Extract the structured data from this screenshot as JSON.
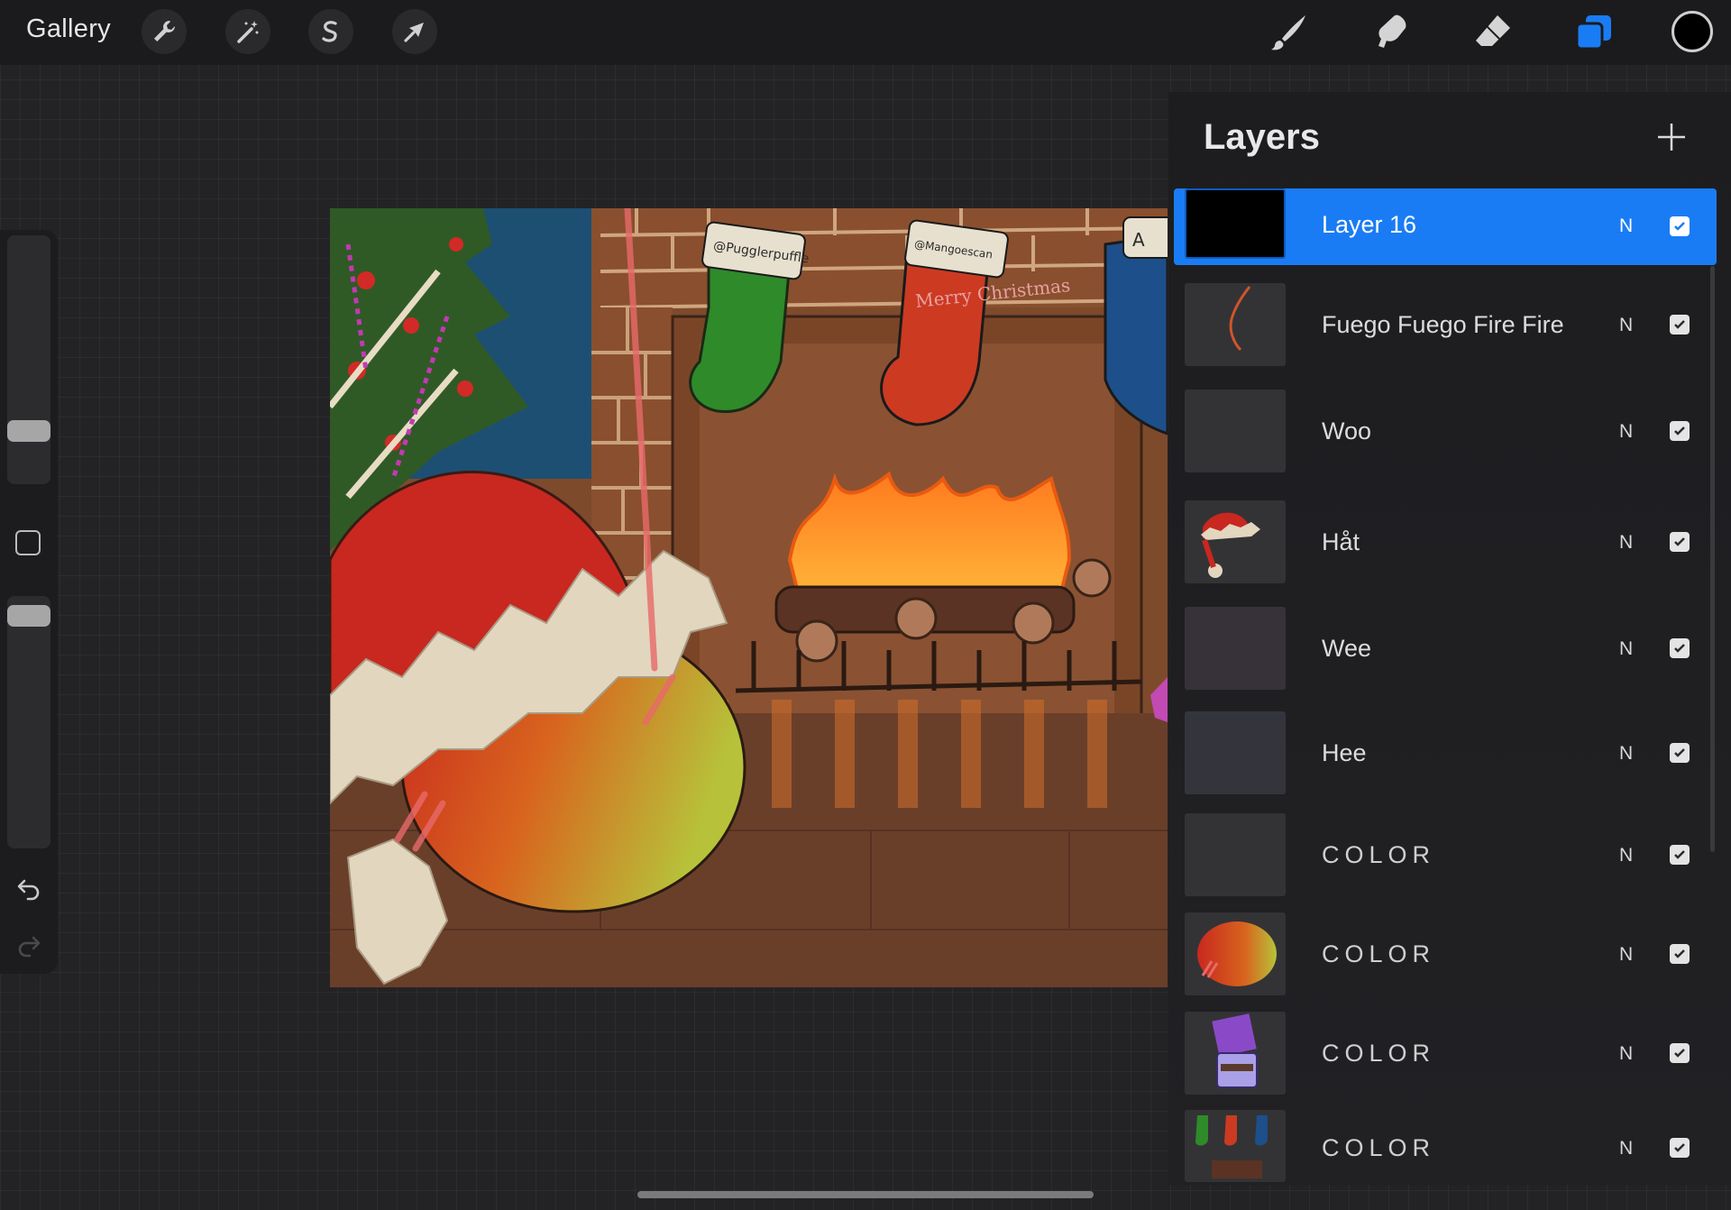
{
  "topbar": {
    "gallery_label": "Gallery",
    "left_tools": [
      "wrench-icon",
      "magic-wand-icon",
      "selection-icon",
      "transform-arrow-icon"
    ],
    "right_tools": [
      "brush-icon",
      "smudge-icon",
      "eraser-icon",
      "layers-icon"
    ],
    "active_tool": "layers-icon",
    "current_color": "#000000",
    "accent_color": "#1a7cf4"
  },
  "sidebar": {
    "brush_size_level": 0.23,
    "opacity_level": 0.08,
    "icons": [
      "modifier-square-icon",
      "undo-icon",
      "redo-icon"
    ]
  },
  "canvas": {
    "stocking_tags": [
      "@Pugglerpuffle",
      "@Mangoescan",
      "A"
    ],
    "stocking_text": "Merry Christmas"
  },
  "layers_panel": {
    "title": "Layers",
    "add_icon": "plus-icon",
    "layers": [
      {
        "name": "Layer 16",
        "blend": "N",
        "visible": true,
        "selected": true
      },
      {
        "name": "Fuego Fuego Fire Fire",
        "blend": "N",
        "visible": true,
        "selected": false
      },
      {
        "name": "Woo",
        "blend": "N",
        "visible": true,
        "selected": false
      },
      {
        "name": "Håt",
        "blend": "N",
        "visible": true,
        "selected": false
      },
      {
        "name": "Wee",
        "blend": "N",
        "visible": true,
        "selected": false
      },
      {
        "name": "Hee",
        "blend": "N",
        "visible": true,
        "selected": false
      },
      {
        "name": "COLOR",
        "blend": "N",
        "visible": true,
        "selected": false
      },
      {
        "name": "COLOR",
        "blend": "N",
        "visible": true,
        "selected": false
      },
      {
        "name": "COLOR",
        "blend": "N",
        "visible": true,
        "selected": false
      },
      {
        "name": "COLOR",
        "blend": "N",
        "visible": true,
        "selected": false
      }
    ]
  }
}
